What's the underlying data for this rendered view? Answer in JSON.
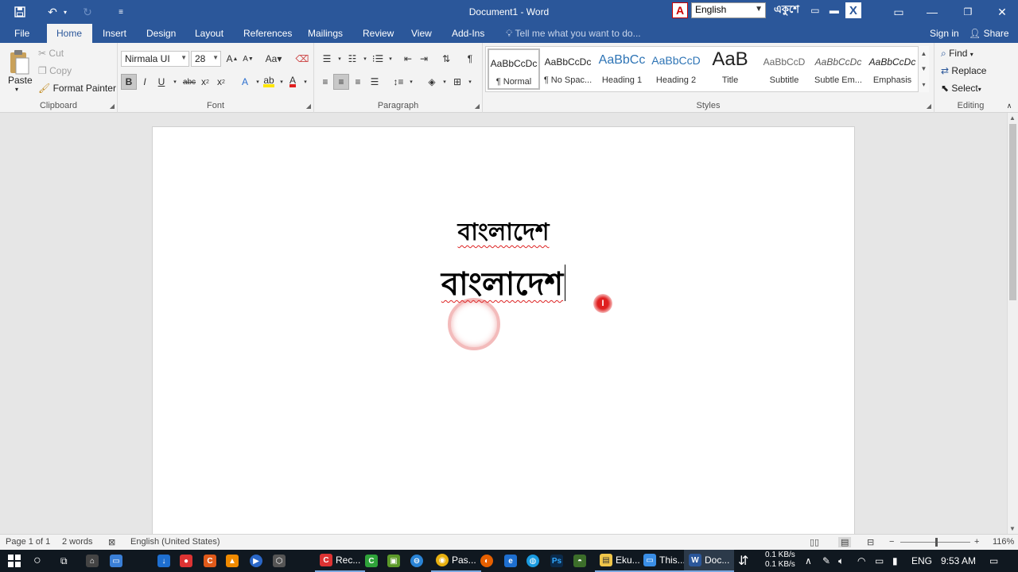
{
  "titlebar": {
    "title": "Document1 - Word",
    "ime_language": "English",
    "ime_label": "একুশে"
  },
  "tabs": [
    "File",
    "Home",
    "Insert",
    "Design",
    "Layout",
    "References",
    "Mailings",
    "Review",
    "View",
    "Add-Ins"
  ],
  "tell_me": "Tell me what you want to do...",
  "sign_in": "Sign in",
  "share": "Share",
  "clipboard": {
    "paste": "Paste",
    "cut": "Cut",
    "copy": "Copy",
    "format_painter": "Format Painter",
    "label": "Clipboard"
  },
  "font": {
    "name": "Nirmala UI",
    "size": "28",
    "label": "Font"
  },
  "paragraph": {
    "label": "Paragraph"
  },
  "styles": {
    "label": "Styles",
    "items": [
      {
        "preview": "AaBbCcDc",
        "name": "¶ Normal"
      },
      {
        "preview": "AaBbCcDc",
        "name": "¶ No Spac..."
      },
      {
        "preview": "AaBbCc",
        "name": "Heading 1"
      },
      {
        "preview": "AaBbCcD",
        "name": "Heading 2"
      },
      {
        "preview": "AaB",
        "name": "Title"
      },
      {
        "preview": "AaBbCcD",
        "name": "Subtitle"
      },
      {
        "preview": "AaBbCcDc",
        "name": "Subtle Em..."
      },
      {
        "preview": "AaBbCcDc",
        "name": "Emphasis"
      }
    ]
  },
  "editing": {
    "find": "Find",
    "replace": "Replace",
    "select": "Select",
    "label": "Editing"
  },
  "document": {
    "line1": "বাংলাদেশ",
    "line2": "বাংলাদেশ"
  },
  "status": {
    "page": "Page 1 of 1",
    "words": "2 words",
    "language": "English (United States)",
    "zoom": "116%"
  },
  "taskbar": {
    "apps": [
      "Rec...",
      "Pas...",
      "Eku...",
      "This...",
      "Doc..."
    ],
    "net_up": "0.1 KB/s",
    "net_down": "0.1 KB/s",
    "lang": "ENG",
    "time": "9:53 AM"
  },
  "colors": {
    "word_blue": "#2b579a",
    "ribbon_bg": "#f3f3f3",
    "taskbar_bg": "#101820"
  }
}
